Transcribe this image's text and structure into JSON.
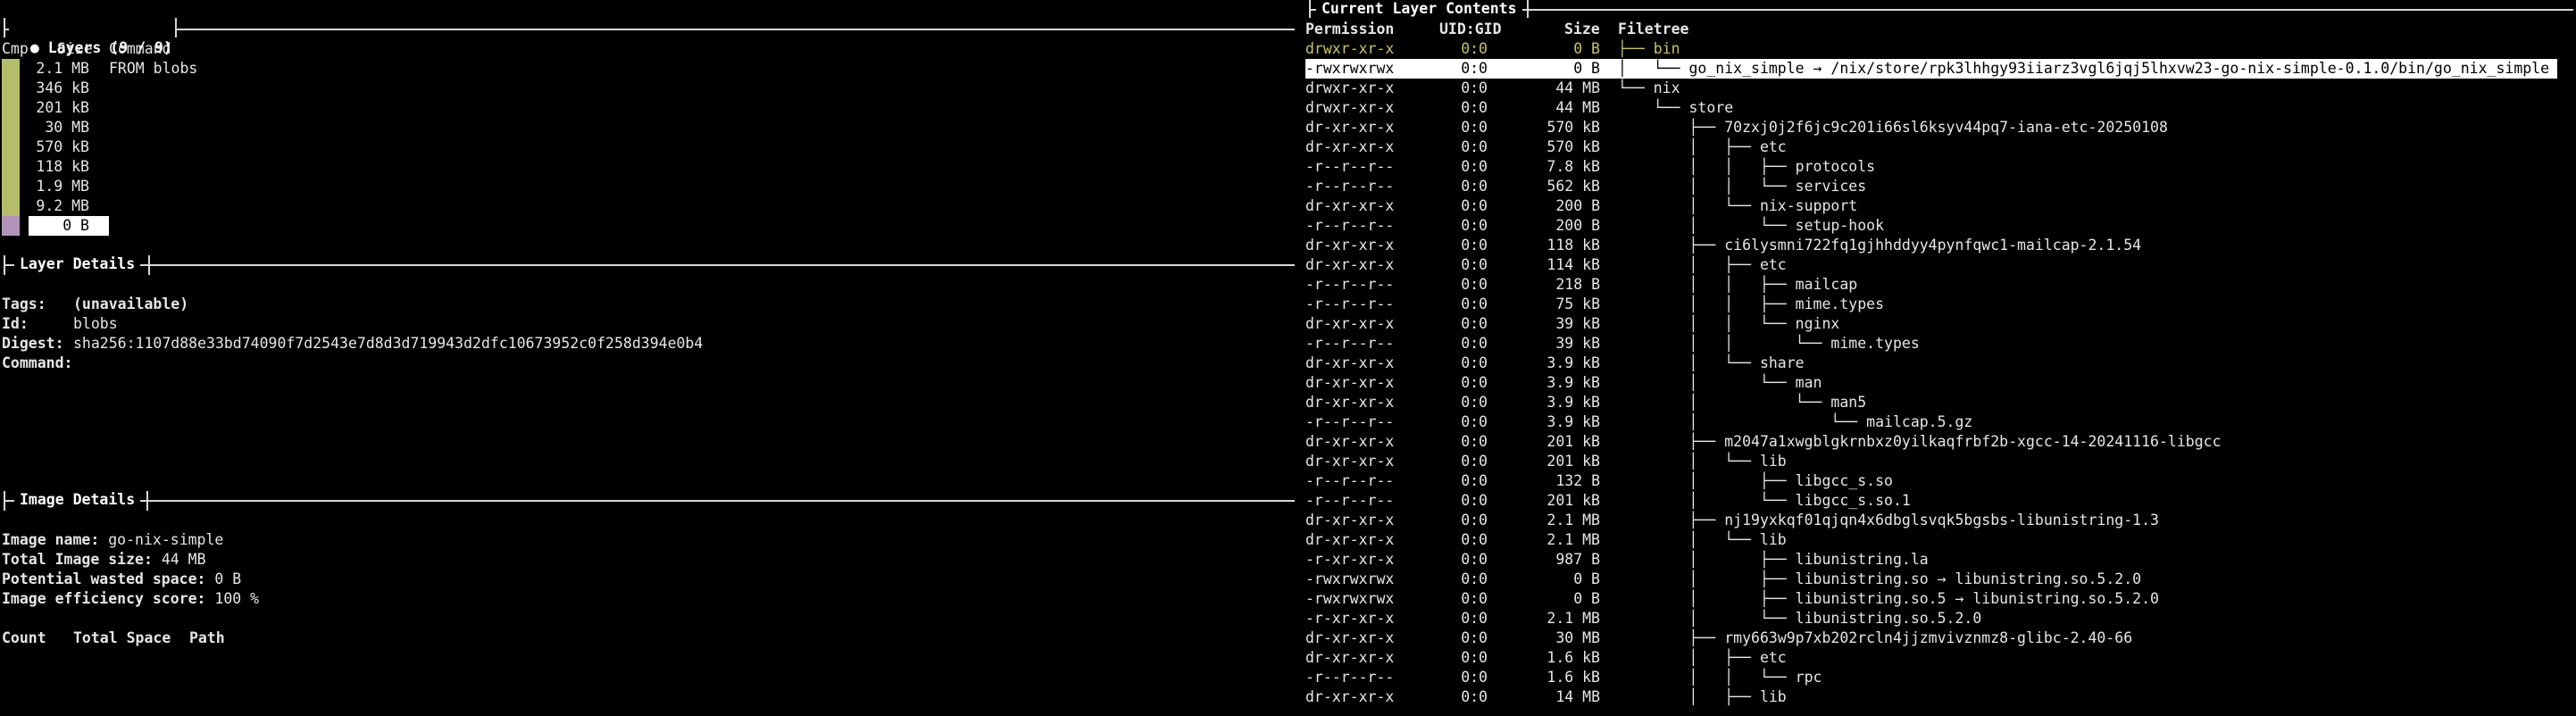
{
  "layers_panel": {
    "title": "Layers (9 / 9)",
    "bullet": "●",
    "headers": {
      "cmp": "Cmp",
      "size": "Size",
      "command": "Command"
    },
    "rows": [
      {
        "size": "2.1 MB",
        "command": "FROM blobs"
      },
      {
        "size": "346 kB",
        "command": ""
      },
      {
        "size": "201 kB",
        "command": ""
      },
      {
        "size": "30 MB",
        "command": ""
      },
      {
        "size": "570 kB",
        "command": ""
      },
      {
        "size": "118 kB",
        "command": ""
      },
      {
        "size": "1.9 MB",
        "command": ""
      },
      {
        "size": "9.2 MB",
        "command": ""
      },
      {
        "size": "0 B",
        "command": ""
      }
    ],
    "bar_colors": {
      "normal": "#b5bd68",
      "selected": "#b294bb"
    }
  },
  "layer_details": {
    "title": "Layer Details",
    "tags_label": "Tags:",
    "tags_value": "(unavailable)",
    "id_label": "Id:",
    "id_value": "blobs",
    "digest_label": "Digest:",
    "digest_value": "sha256:1107d88e33bd74090f7d2543e7d8d3d719943d2dfc10673952c0f258d394e0b4",
    "command_label": "Command:"
  },
  "image_details": {
    "title": "Image Details",
    "name_label": "Image name:",
    "name_value": "go-nix-simple",
    "size_label": "Total Image size:",
    "size_value": "44 MB",
    "wasted_label": "Potential wasted space:",
    "wasted_value": "0 B",
    "efficiency_label": "Image efficiency score:",
    "efficiency_value": "100 %",
    "table_headers": {
      "count": "Count",
      "total_space": "Total Space",
      "path": "Path"
    }
  },
  "contents_panel": {
    "title": "Current Layer Contents",
    "headers": {
      "permission": "Permission",
      "uid_gid": "UID:GID",
      "size": "Size",
      "filetree": "Filetree"
    },
    "rows": [
      {
        "perm": "drwxr-xr-x",
        "uid": "0:0",
        "size": "0 B",
        "tree": "├── bin",
        "style": "yellow"
      },
      {
        "perm": "-rwxrwxrwx",
        "uid": "0:0",
        "size": "0 B",
        "tree": "│   └── go_nix_simple → /nix/store/rpk3lhhgy93iiarz3vgl6jqj5lhxvw23-go-nix-simple-0.1.0/bin/go_nix_simple",
        "style": "selected"
      },
      {
        "perm": "drwxr-xr-x",
        "uid": "0:0",
        "size": "44 MB",
        "tree": "└── nix",
        "style": ""
      },
      {
        "perm": "drwxr-xr-x",
        "uid": "0:0",
        "size": "44 MB",
        "tree": "    └── store",
        "style": ""
      },
      {
        "perm": "dr-xr-xr-x",
        "uid": "0:0",
        "size": "570 kB",
        "tree": "        ├── 70zxj0j2f6jc9c201i66sl6ksyv44pq7-iana-etc-20250108",
        "style": ""
      },
      {
        "perm": "dr-xr-xr-x",
        "uid": "0:0",
        "size": "570 kB",
        "tree": "        │   ├── etc",
        "style": ""
      },
      {
        "perm": "-r--r--r--",
        "uid": "0:0",
        "size": "7.8 kB",
        "tree": "        │   │   ├── protocols",
        "style": ""
      },
      {
        "perm": "-r--r--r--",
        "uid": "0:0",
        "size": "562 kB",
        "tree": "        │   │   └── services",
        "style": ""
      },
      {
        "perm": "dr-xr-xr-x",
        "uid": "0:0",
        "size": "200 B",
        "tree": "        │   └── nix-support",
        "style": ""
      },
      {
        "perm": "-r--r--r--",
        "uid": "0:0",
        "size": "200 B",
        "tree": "        │       └── setup-hook",
        "style": ""
      },
      {
        "perm": "dr-xr-xr-x",
        "uid": "0:0",
        "size": "118 kB",
        "tree": "        ├── ci6lysmni722fq1gjhhddyy4pynfqwc1-mailcap-2.1.54",
        "style": ""
      },
      {
        "perm": "dr-xr-xr-x",
        "uid": "0:0",
        "size": "114 kB",
        "tree": "        │   ├── etc",
        "style": ""
      },
      {
        "perm": "-r--r--r--",
        "uid": "0:0",
        "size": "218 B",
        "tree": "        │   │   ├── mailcap",
        "style": ""
      },
      {
        "perm": "-r--r--r--",
        "uid": "0:0",
        "size": "75 kB",
        "tree": "        │   │   ├── mime.types",
        "style": ""
      },
      {
        "perm": "dr-xr-xr-x",
        "uid": "0:0",
        "size": "39 kB",
        "tree": "        │   │   └── nginx",
        "style": ""
      },
      {
        "perm": "-r--r--r--",
        "uid": "0:0",
        "size": "39 kB",
        "tree": "        │   │       └── mime.types",
        "style": ""
      },
      {
        "perm": "dr-xr-xr-x",
        "uid": "0:0",
        "size": "3.9 kB",
        "tree": "        │   └── share",
        "style": ""
      },
      {
        "perm": "dr-xr-xr-x",
        "uid": "0:0",
        "size": "3.9 kB",
        "tree": "        │       └── man",
        "style": ""
      },
      {
        "perm": "dr-xr-xr-x",
        "uid": "0:0",
        "size": "3.9 kB",
        "tree": "        │           └── man5",
        "style": ""
      },
      {
        "perm": "-r--r--r--",
        "uid": "0:0",
        "size": "3.9 kB",
        "tree": "        │               └── mailcap.5.gz",
        "style": ""
      },
      {
        "perm": "dr-xr-xr-x",
        "uid": "0:0",
        "size": "201 kB",
        "tree": "        ├── m2047a1xwgblgkrnbxz0yilkaqfrbf2b-xgcc-14-20241116-libgcc",
        "style": ""
      },
      {
        "perm": "dr-xr-xr-x",
        "uid": "0:0",
        "size": "201 kB",
        "tree": "        │   └── lib",
        "style": ""
      },
      {
        "perm": "-r--r--r--",
        "uid": "0:0",
        "size": "132 B",
        "tree": "        │       ├── libgcc_s.so",
        "style": ""
      },
      {
        "perm": "-r--r--r--",
        "uid": "0:0",
        "size": "201 kB",
        "tree": "        │       └── libgcc_s.so.1",
        "style": ""
      },
      {
        "perm": "dr-xr-xr-x",
        "uid": "0:0",
        "size": "2.1 MB",
        "tree": "        ├── nj19yxkqf01qjqn4x6dbglsvqk5bgsbs-libunistring-1.3",
        "style": ""
      },
      {
        "perm": "dr-xr-xr-x",
        "uid": "0:0",
        "size": "2.1 MB",
        "tree": "        │   └── lib",
        "style": ""
      },
      {
        "perm": "-r-xr-xr-x",
        "uid": "0:0",
        "size": "987 B",
        "tree": "        │       ├── libunistring.la",
        "style": ""
      },
      {
        "perm": "-rwxrwxrwx",
        "uid": "0:0",
        "size": "0 B",
        "tree": "        │       ├── libunistring.so → libunistring.so.5.2.0",
        "style": ""
      },
      {
        "perm": "-rwxrwxrwx",
        "uid": "0:0",
        "size": "0 B",
        "tree": "        │       ├── libunistring.so.5 → libunistring.so.5.2.0",
        "style": ""
      },
      {
        "perm": "-r-xr-xr-x",
        "uid": "0:0",
        "size": "2.1 MB",
        "tree": "        │       └── libunistring.so.5.2.0",
        "style": ""
      },
      {
        "perm": "dr-xr-xr-x",
        "uid": "0:0",
        "size": "30 MB",
        "tree": "        ├── rmy663w9p7xb202rcln4jjzmvivznmz8-glibc-2.40-66",
        "style": ""
      },
      {
        "perm": "dr-xr-xr-x",
        "uid": "0:0",
        "size": "1.6 kB",
        "tree": "        │   ├── etc",
        "style": ""
      },
      {
        "perm": "-r--r--r--",
        "uid": "0:0",
        "size": "1.6 kB",
        "tree": "        │   │   └── rpc",
        "style": ""
      },
      {
        "perm": "dr-xr-xr-x",
        "uid": "0:0",
        "size": "14 MB",
        "tree": "        │   ├── lib",
        "style": ""
      }
    ]
  }
}
